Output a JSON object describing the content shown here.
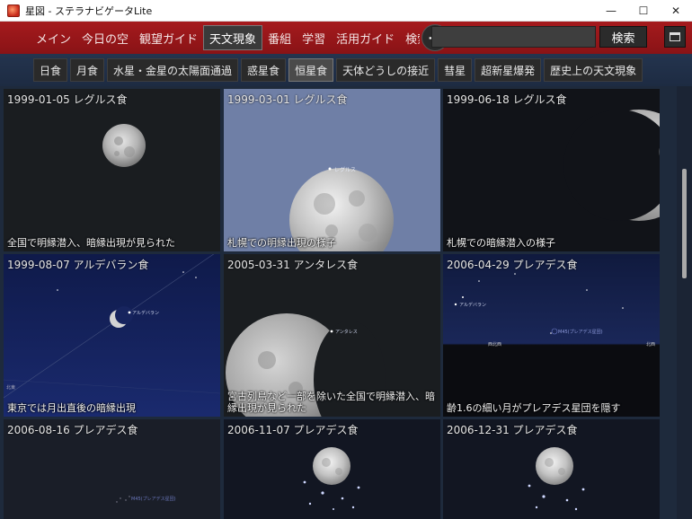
{
  "window": {
    "title": "星図 - ステラナビゲータLite",
    "controls": {
      "minimize": "—",
      "maximize": "☐",
      "close": "✕"
    }
  },
  "menu": {
    "items": [
      {
        "label": "メイン"
      },
      {
        "label": "今日の空"
      },
      {
        "label": "観望ガイド"
      },
      {
        "label": "天文現象"
      },
      {
        "label": "番組"
      },
      {
        "label": "学習"
      },
      {
        "label": "活用ガイド"
      },
      {
        "label": "検索"
      }
    ],
    "active_index": 3,
    "search_placeholder": "",
    "search_button": "検索",
    "go_icon": "arrow-right-icon",
    "panel_icon": "window-panel-icon"
  },
  "categories": {
    "items": [
      {
        "label": "日食"
      },
      {
        "label": "月食"
      },
      {
        "label": "水星・金星の太陽面通過"
      },
      {
        "label": "惑星食"
      },
      {
        "label": "恒星食"
      },
      {
        "label": "天体どうしの接近"
      },
      {
        "label": "彗星"
      },
      {
        "label": "超新星爆発"
      },
      {
        "label": "歴史上の天文現象"
      }
    ],
    "active_index": 4
  },
  "cards": [
    {
      "title": "1999-01-05 レグルス食",
      "caption": "全国で明縁潜入、暗縁出現が見られた",
      "scene": "moon-small-dark"
    },
    {
      "title": "1999-03-01 レグルス食",
      "caption": "札幌での明縁出現の様子",
      "scene": "moon-large-blue",
      "star_label": "レグルス"
    },
    {
      "title": "1999-06-18 レグルス食",
      "caption": "札幌での暗縁潜入の様子",
      "scene": "crescent-right"
    },
    {
      "title": "1999-08-07 アルデバラン食",
      "caption": "東京では月出直後の暗縁出現",
      "scene": "crescent-small-blue",
      "star_label": "アルデバラン",
      "horizon_label": "北東"
    },
    {
      "title": "2005-03-31 アンタレス食",
      "caption": "宮古列島など一部を除いた全国で明縁潜入、暗縁出現が見られた",
      "scene": "moon-gibbous-dark",
      "star_label": "アンタレス"
    },
    {
      "title": "2006-04-29 プレアデス食",
      "caption": "齢1.6の細い月がプレアデス星団を隠す",
      "scene": "stars-pleiades",
      "star_label": "アルデバラン",
      "cluster_label": "M45(プレアデス星団)",
      "horizon_labels": [
        "西北西",
        "北西"
      ]
    },
    {
      "title": "2006-08-16 プレアデス食",
      "caption": "",
      "scene": "dark-pleiades",
      "cluster_label": "M45(プレアデス星団)"
    },
    {
      "title": "2006-11-07 プレアデス食",
      "caption": "",
      "scene": "moon-pleiades"
    },
    {
      "title": "2006-12-31 プレアデス食",
      "caption": "",
      "scene": "moon-pleiades-2"
    }
  ]
}
